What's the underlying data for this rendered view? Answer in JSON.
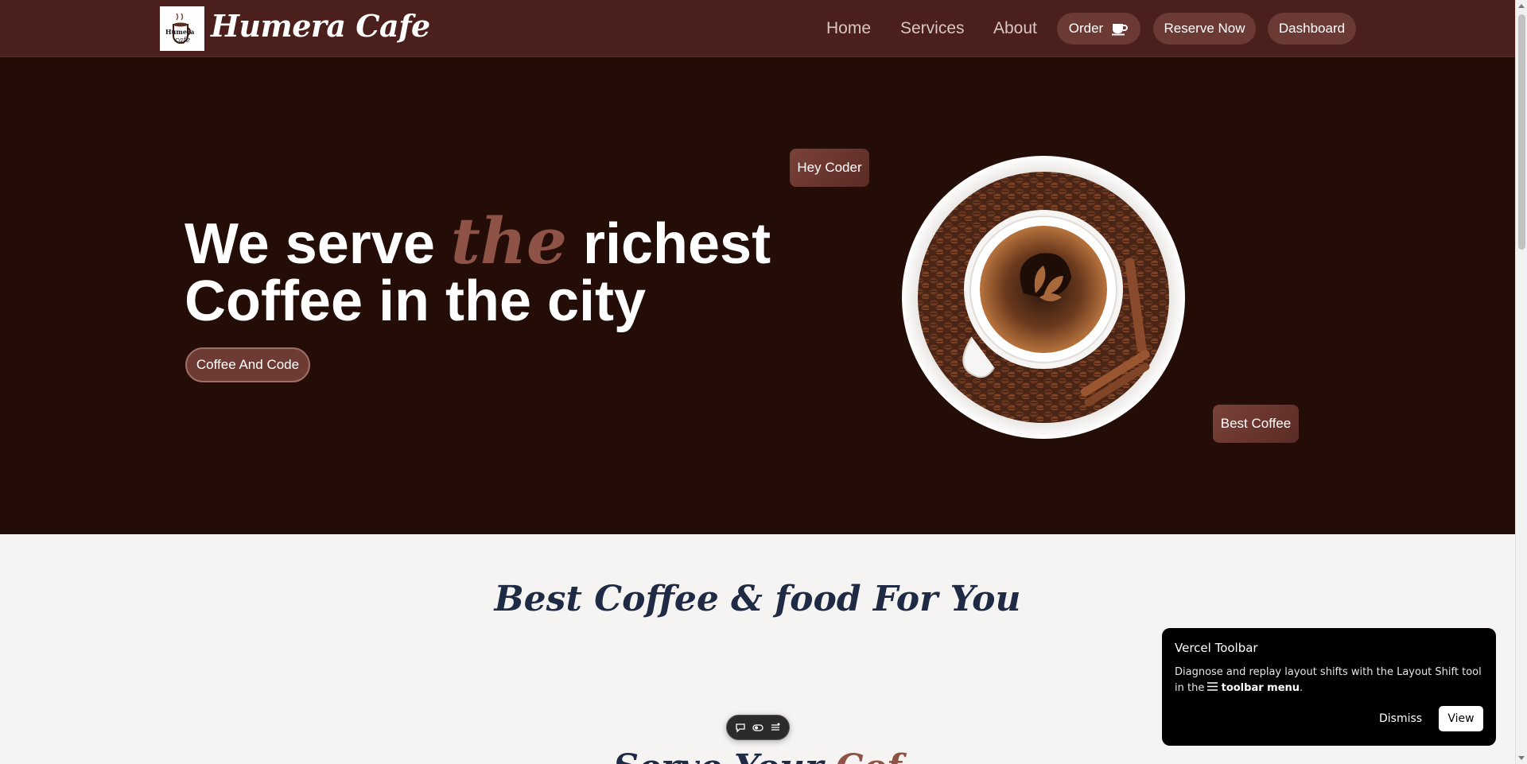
{
  "navbar": {
    "brand": "Humera Cafe",
    "logo_text": "Humera cafe",
    "links": [
      "Home",
      "Services",
      "About"
    ],
    "order_label": "Order",
    "reserve_label": "Reserve Now",
    "dashboard_label": "Dashboard"
  },
  "hero": {
    "heading_part1": "We serve",
    "heading_accent": "the",
    "heading_part2": "richest",
    "heading_line2": "Coffee in the city",
    "cta_label": "Coffee And Code",
    "tag_top": "Hey Coder",
    "tag_bottom": "Best Coffee"
  },
  "section": {
    "title": "Best Coffee & food For You",
    "next_title_part1": "Serve Your",
    "next_title_accent": "Cof"
  },
  "vercel": {
    "title": "Vercel Toolbar",
    "text_before": "Diagnose and replay layout shifts with the Layout Shift tool in the",
    "text_bold": "toolbar menu",
    "text_after": ".",
    "dismiss_label": "Dismiss",
    "view_label": "View"
  },
  "colors": {
    "navbar_bg": "#4a1f1c",
    "hero_bg": "#250d07",
    "accent": "#8e5346",
    "pill_bg": "#6b3a35",
    "page_bg": "#f5f4f2",
    "title_color": "#1f2a44"
  },
  "icons": {
    "order": "coffee-cup-icon",
    "toolbar": [
      "comment-icon",
      "toggle-icon",
      "menu-icon"
    ]
  }
}
